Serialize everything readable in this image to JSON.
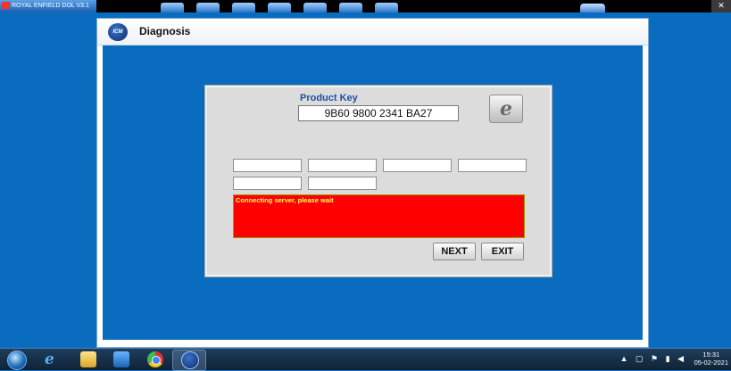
{
  "topbar": {
    "app_tab_title": "ROYAL ENFIELD DOL V3.1",
    "close_label": "✕"
  },
  "window": {
    "logo_text": "ICM",
    "title": "Diagnosis"
  },
  "dialog": {
    "product_key_label": "Product Key",
    "product_key_value": "9B60 9800 2341 BA27",
    "ie_icon": "internet-explorer-icon",
    "serial_fields": [
      "",
      "",
      "",
      "",
      "",
      ""
    ],
    "status_message": "Connecting server, please wait",
    "status_bg_color": "#ff0000",
    "status_text_color": "#ffff66",
    "next_label": "NEXT",
    "exit_label": "EXIT"
  },
  "taskbar": {
    "time": "15:31",
    "date": "05-02-2021",
    "tray_icons": "▲ ▢ ⚑ ▮ ◀"
  }
}
